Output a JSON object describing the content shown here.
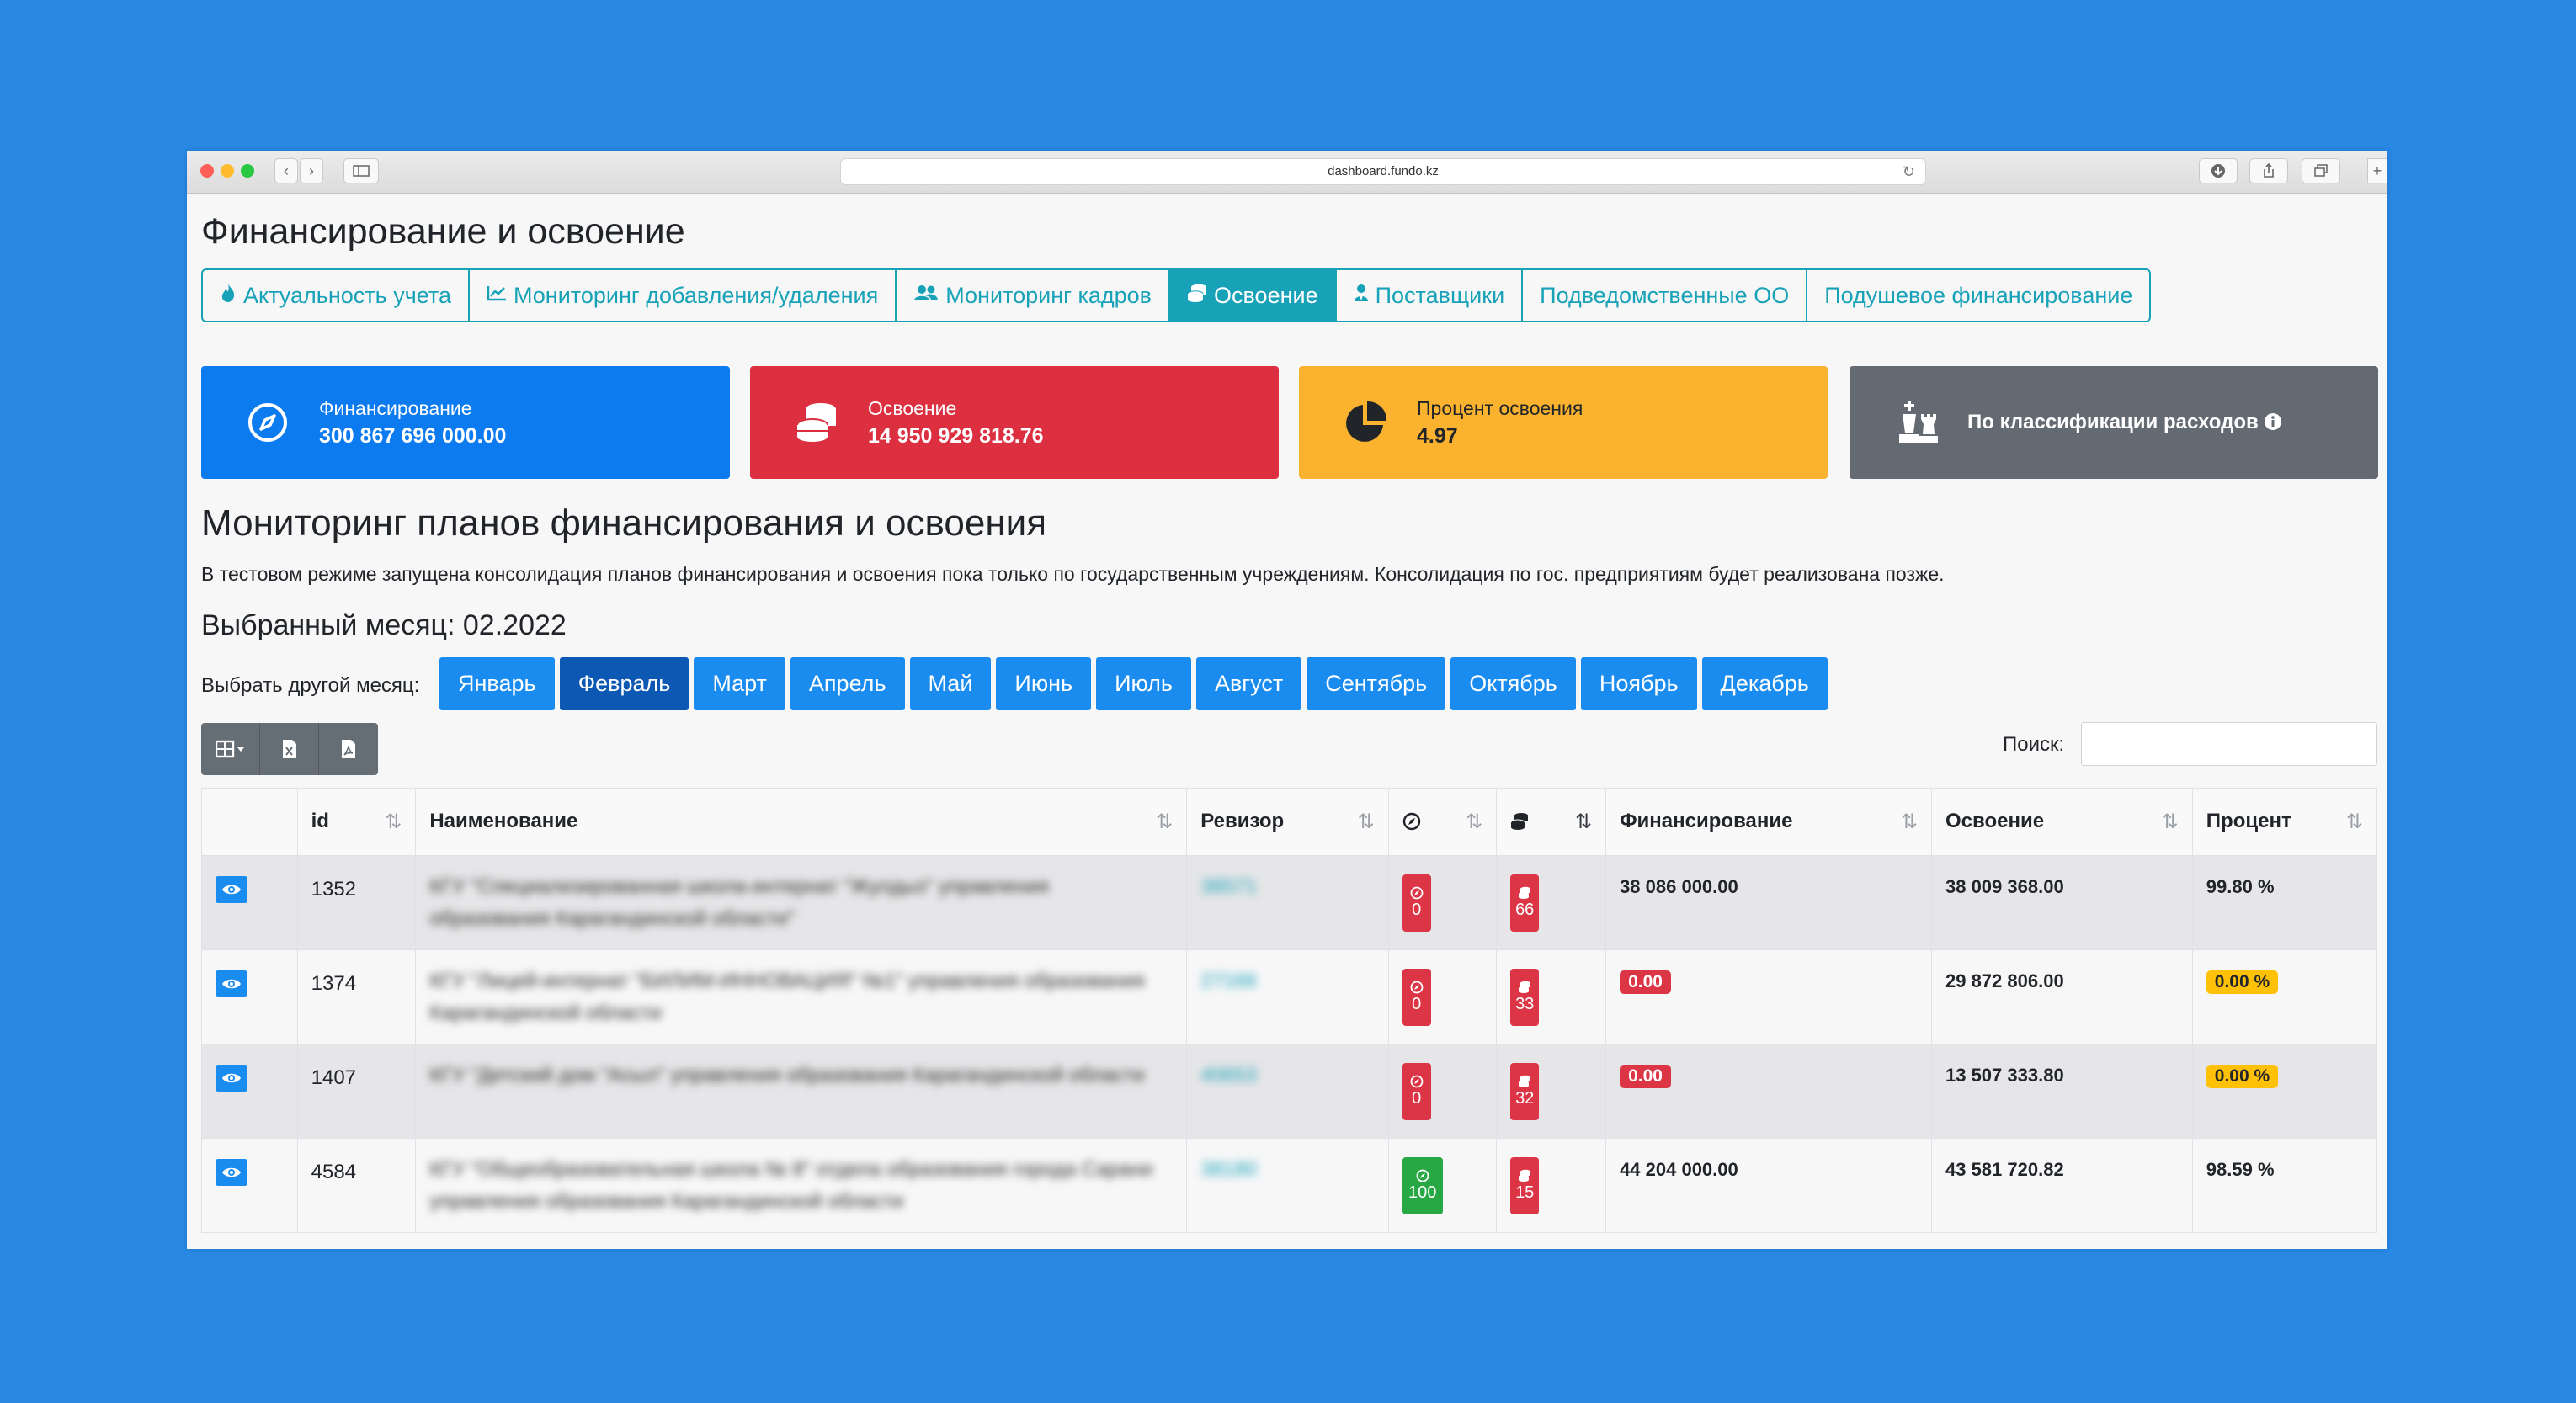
{
  "browser": {
    "url": "dashboard.fundo.kz"
  },
  "page_title": "Финансирование и освоение",
  "nav_tabs": [
    {
      "label": "Актуальность учета"
    },
    {
      "label": "Мониторинг добавления/удаления"
    },
    {
      "label": "Мониторинг кадров"
    },
    {
      "label": "Освоение",
      "active": true
    },
    {
      "label": "Поставщики"
    },
    {
      "label": "Подведомственные ОО"
    },
    {
      "label": "Подушевое финансирование"
    }
  ],
  "stats": [
    {
      "label": "Финансирование",
      "value": "300 867 696 000.00",
      "color": "#0d7bf0"
    },
    {
      "label": "Освоение",
      "value": "14 950 929 818.76",
      "color": "#dc2f3f"
    },
    {
      "label": "Процент освоения",
      "value": "4.97",
      "color": "#fbb22f"
    },
    {
      "label": "По классификации расходов",
      "color": "#636a71"
    }
  ],
  "section": {
    "title": "Мониторинг планов финансирования и освоения",
    "description": "В тестовом режиме запущена консолидация планов финансирования и освоения пока только по государственным учреждениям. Консолидация по гос. предприятиям будет реализована позже.",
    "selected_month": "Выбранный месяц: 02.2022",
    "choose_month_label": "Выбрать другой месяц:"
  },
  "months": [
    "Январь",
    "Февраль",
    "Март",
    "Апрель",
    "Май",
    "Июнь",
    "Июль",
    "Август",
    "Сентябрь",
    "Октябрь",
    "Ноябрь",
    "Декабрь"
  ],
  "active_month": "Февраль",
  "search": {
    "label": "Поиск:",
    "value": ""
  },
  "table": {
    "headers": {
      "id": "id",
      "name": "Наименование",
      "revisor": "Ревизор",
      "financing": "Финансирование",
      "usage": "Освоение",
      "percent": "Процент"
    },
    "rows": [
      {
        "id": "1352",
        "name": "КГУ \"Специализированная школа-интернат \"Жулдыз\" управления образования Карагандинской области\"",
        "revisor": "38571",
        "badge1": "0",
        "badge1_color": "red",
        "badge2": "66",
        "financing": "38 086 000.00",
        "financing_style": "plain",
        "usage": "38 009 368.00",
        "percent": "99.80 %",
        "percent_style": "plain"
      },
      {
        "id": "1374",
        "name": "КГУ \"Лицей-интернат \"БИЛИМ-ИННОВАЦИЯ\" №1\" управления образования Карагандинской области",
        "revisor": "27166",
        "badge1": "0",
        "badge1_color": "red",
        "badge2": "33",
        "financing": "0.00",
        "financing_style": "red",
        "usage": "29 872 806.00",
        "percent": "0.00 %",
        "percent_style": "yellow"
      },
      {
        "id": "1407",
        "name": "КГУ \"Детский дом \"Асыл\" управления образования Карагандинской области",
        "revisor": "40653",
        "badge1": "0",
        "badge1_color": "red",
        "badge2": "32",
        "financing": "0.00",
        "financing_style": "red",
        "usage": "13 507 333.80",
        "percent": "0.00 %",
        "percent_style": "yellow"
      },
      {
        "id": "4584",
        "name": "КГУ \"Общеобразовательная школа № 8\" отдела образования города Сарани управления образования Карагандинской области",
        "revisor": "38180",
        "badge1": "100",
        "badge1_color": "green",
        "badge2": "15",
        "financing": "44 204 000.00",
        "financing_style": "plain",
        "usage": "43 581 720.82",
        "percent": "98.59 %",
        "percent_style": "plain"
      }
    ]
  }
}
